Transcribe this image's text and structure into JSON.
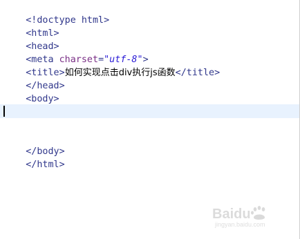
{
  "editor": {
    "lines": {
      "doctype": "<!doctype html>",
      "html_open": "<html>",
      "head_open": "<head>",
      "meta_tag_start": "<meta ",
      "meta_attr": "charset",
      "meta_eq": "=",
      "meta_value": "\"utf-8\"",
      "meta_tag_end": ">",
      "title_open": "<title>",
      "title_text": "如何实现点击div执行js函数",
      "title_close": "</title>",
      "head_close": "</head>",
      "body_open": "<body>",
      "body_close": "</body>",
      "html_close": "</html>"
    },
    "colors": {
      "tag": "#30378b",
      "attribute": "#7a2f86",
      "value": "#2a1bd6",
      "current_line": "#e8f2fe"
    }
  },
  "watermark": {
    "brand": "Baidu",
    "subtitle": "jingyan.baidu.com"
  }
}
